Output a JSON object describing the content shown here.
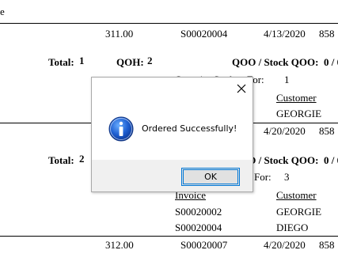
{
  "report": {
    "top_fragment": "e",
    "block1": {
      "amount": "311.00",
      "order_no": "S00020004",
      "date": "4/13/2020",
      "trailing": "858",
      "total_label": "Total:",
      "total_value": "1",
      "qoh_label": "QOH:",
      "qoh_value": "2",
      "qoo_label": "QOO / Stock QOO:",
      "qoo_value": "0 / 0",
      "qty_spoken_label": "Quantity Spoken For:",
      "qty_spoken_value": "1",
      "customer_header": "Customer",
      "customer_1": "GEORGIE"
    },
    "block2": {
      "date": "4/20/2020",
      "trailing": "858",
      "total_label": "Total:",
      "total_value": "2",
      "qoo_label": "QOO / Stock QOO:",
      "qoo_value": "0 / 0",
      "for_label": "For:",
      "for_value": "3",
      "invoice_header": "Invoice",
      "customer_header": "Customer",
      "invoices": [
        "S00020002",
        "S00020004"
      ],
      "customers": [
        "GEORGIE",
        "DIEGO"
      ]
    },
    "block3": {
      "amount": "312.00",
      "order_no": "S00020007",
      "date": "4/20/2020",
      "trailing": "858"
    }
  },
  "dialog": {
    "message": "Ordered Successfully!",
    "ok_label": "OK",
    "icon": "info-icon",
    "accent_color": "#0078d7"
  }
}
